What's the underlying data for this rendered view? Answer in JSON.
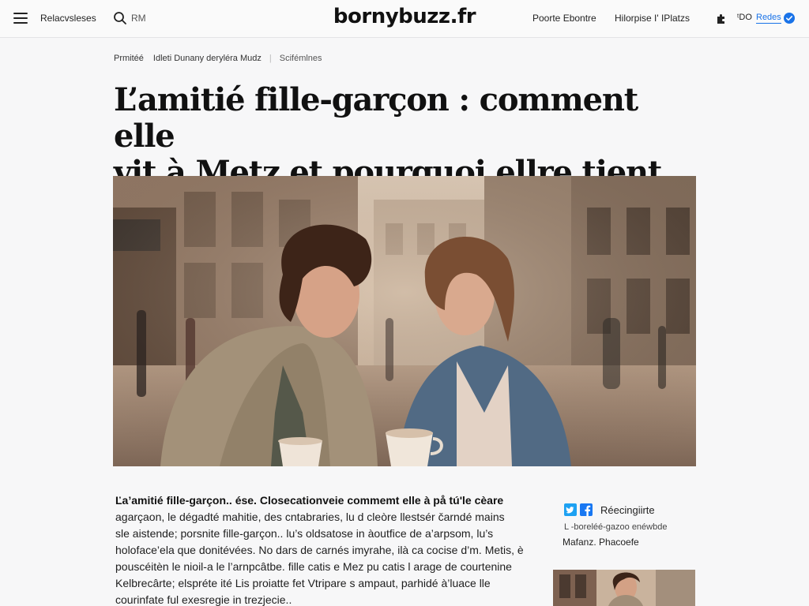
{
  "header": {
    "menu_icon": "hamburger-menu-icon",
    "nav_left": "Relacvsleses",
    "search_icon": "search-icon",
    "search_placeholder": "RM",
    "logo": "bornybuzz.fr",
    "nav_right_1": "Poorte Ebontre",
    "nav_right_2": "Hilorpise I' IPlatzs",
    "extension_icon": "puzzle-icon",
    "count_text": "ᵗDO",
    "reader_label": "Redes",
    "check_icon": "check-circle-icon",
    "accent_color": "#1a73e8"
  },
  "breadcrumb": {
    "label": "Prmitéé",
    "author": "Idleti Dunany  deryléra Mudz",
    "category": "Scifémlnes"
  },
  "article": {
    "title_line1": "L’amitié fille-garçon : comment elle",
    "title_line2": "vit à Metz et pourquoi ellre tient",
    "hero_alt": "Two young people talking at a café terrace in a city street",
    "lead": "Ľa’amitié fille-garçon.. ése. Closecationveie commemt elle à på tú'le cèare",
    "lines": [
      "agarçaon,  le dégadté mahitie, des cntabraries,  lu d cleòre llestsér čarndé mains",
      "sle aistende;  porsnite fille-garçon.. lu’s oldsatose in àoutfice de a’arpsom, lu’s",
      "holoface’ela que donitévées. No dars de carnés imyrahe, ilà ca cocise d’m. Metis, è",
      "pouscéitèn le nioil-a le l’arnpcâtbe. fille catis e Mez pu catis l arage de courtenine",
      "Kelbrecârte;  elspréte ité Lis proiatte fet Vtripare s ampaut, parhidé à’luace lle",
      "courinfate ful exesregie in trezjecie.."
    ]
  },
  "sidebar": {
    "twitter_icon": "twitter-icon",
    "facebook_icon": "facebook-icon",
    "share_label": "Réecingiirte",
    "meta_line": "L -boreléé-gazoo enéwbde",
    "author_line": "Mafanz. Phacoefe",
    "thumb_alt": "Related article thumbnail"
  }
}
